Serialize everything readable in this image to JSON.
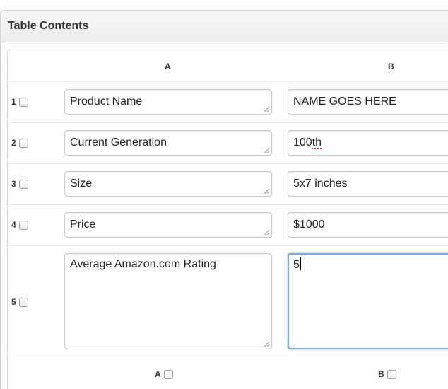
{
  "panel": {
    "title": "Table Contents"
  },
  "table": {
    "columns": [
      "A",
      "B"
    ],
    "rows": [
      {
        "num": "1",
        "a": "Product Name",
        "b": "NAME GOES HERE"
      },
      {
        "num": "2",
        "a": "Current Generation",
        "b_prefix": "100",
        "b_spell": "th"
      },
      {
        "num": "3",
        "a": "Size",
        "b": "5x7 inches"
      },
      {
        "num": "4",
        "a": "Price",
        "b": "$1000"
      },
      {
        "num": "5",
        "a": "Average Amazon.com Rating",
        "b": "5"
      }
    ],
    "footer_columns": [
      "A",
      "B"
    ]
  }
}
